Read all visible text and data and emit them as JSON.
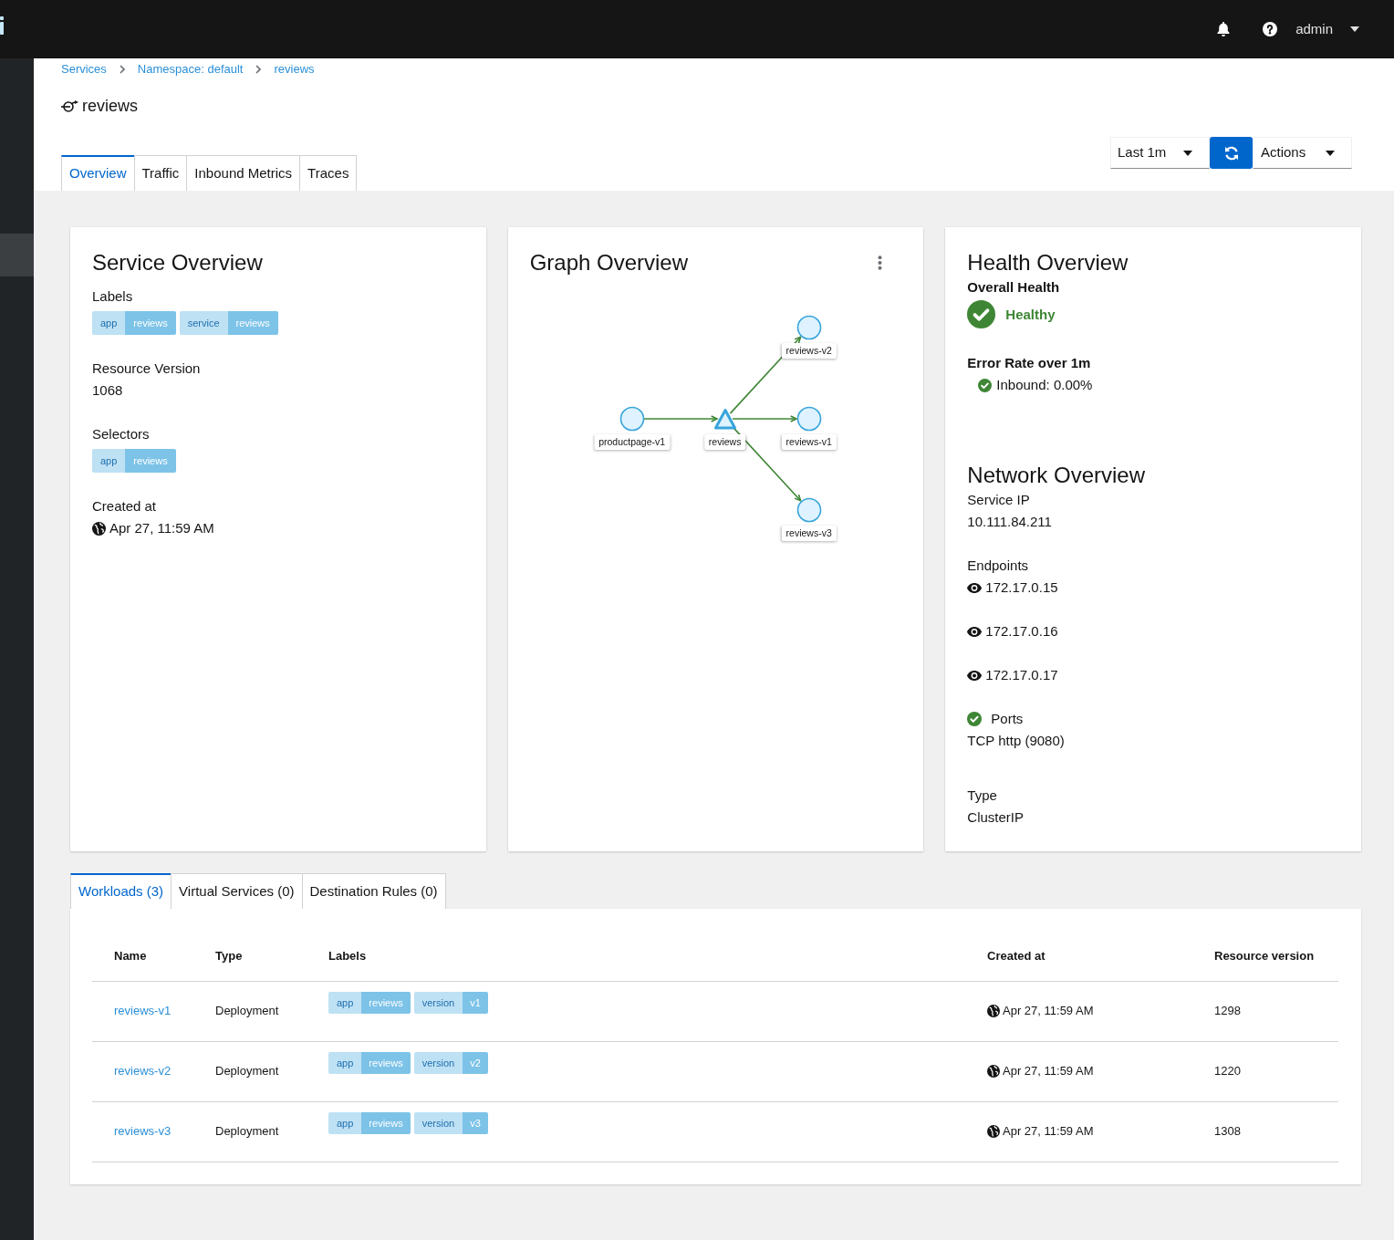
{
  "masthead": {
    "user": "admin"
  },
  "breadcrumb": [
    "Services",
    "Namespace: default",
    "reviews"
  ],
  "page_title": "reviews",
  "tabs": [
    {
      "label": "Overview",
      "selected": true
    },
    {
      "label": "Traffic",
      "selected": false
    },
    {
      "label": "Inbound Metrics",
      "selected": false
    },
    {
      "label": "Traces",
      "selected": false
    }
  ],
  "toolbar": {
    "duration": "Last 1m",
    "actions": "Actions"
  },
  "service_overview": {
    "title": "Service Overview",
    "labels_heading": "Labels",
    "labels": [
      {
        "key": "app",
        "value": "reviews"
      },
      {
        "key": "service",
        "value": "reviews"
      }
    ],
    "resource_version_heading": "Resource Version",
    "resource_version": "1068",
    "selectors_heading": "Selectors",
    "selectors": [
      {
        "key": "app",
        "value": "reviews"
      }
    ],
    "created_heading": "Created at",
    "created": "Apr 27, 11:59 AM"
  },
  "graph_overview": {
    "title": "Graph Overview",
    "nodes": [
      {
        "label": "productpage-v1",
        "kind": "workload",
        "children": [
          {
            "label": "reviews",
            "kind": "service",
            "children": [
              {
                "label": "reviews-v2",
                "kind": "workload"
              },
              {
                "label": "reviews-v1",
                "kind": "workload"
              },
              {
                "label": "reviews-v3",
                "kind": "workload"
              }
            ]
          }
        ]
      }
    ]
  },
  "health_overview": {
    "title": "Health Overview",
    "overall_heading": "Overall Health",
    "status": "Healthy",
    "healthy": true,
    "error_rate_heading": "Error Rate over 1m",
    "error_rates": [
      {
        "text": "Inbound: 0.00%",
        "healthy": true
      }
    ]
  },
  "network_overview": {
    "title": "Network Overview",
    "service_ip_heading": "Service IP",
    "service_ip": "10.111.84.211",
    "endpoints_heading": "Endpoints",
    "endpoints": [
      "172.17.0.15",
      "172.17.0.16",
      "172.17.0.17"
    ],
    "ports_heading": "Ports",
    "ports_healthy": true,
    "ports": [
      "TCP http (9080)"
    ],
    "type_heading": "Type",
    "type": "ClusterIP"
  },
  "detail_tabs": [
    {
      "label": "Workloads (3)",
      "selected": true
    },
    {
      "label": "Virtual Services (0)",
      "selected": false
    },
    {
      "label": "Destination Rules (0)",
      "selected": false
    }
  ],
  "workloads_table": {
    "columns": [
      "Name",
      "Type",
      "Labels",
      "Created at",
      "Resource version"
    ],
    "rows": [
      {
        "name": "reviews-v1",
        "type": "Deployment",
        "labels": [
          {
            "key": "app",
            "value": "reviews"
          },
          {
            "key": "version",
            "value": "v1"
          }
        ],
        "created": "Apr 27, 11:59 AM",
        "resource_version": "1298"
      },
      {
        "name": "reviews-v2",
        "type": "Deployment",
        "labels": [
          {
            "key": "app",
            "value": "reviews"
          },
          {
            "key": "version",
            "value": "v2"
          }
        ],
        "created": "Apr 27, 11:59 AM",
        "resource_version": "1220"
      },
      {
        "name": "reviews-v3",
        "type": "Deployment",
        "labels": [
          {
            "key": "app",
            "value": "reviews"
          },
          {
            "key": "version",
            "value": "v3"
          }
        ],
        "created": "Apr 27, 11:59 AM",
        "resource_version": "1308"
      }
    ]
  }
}
